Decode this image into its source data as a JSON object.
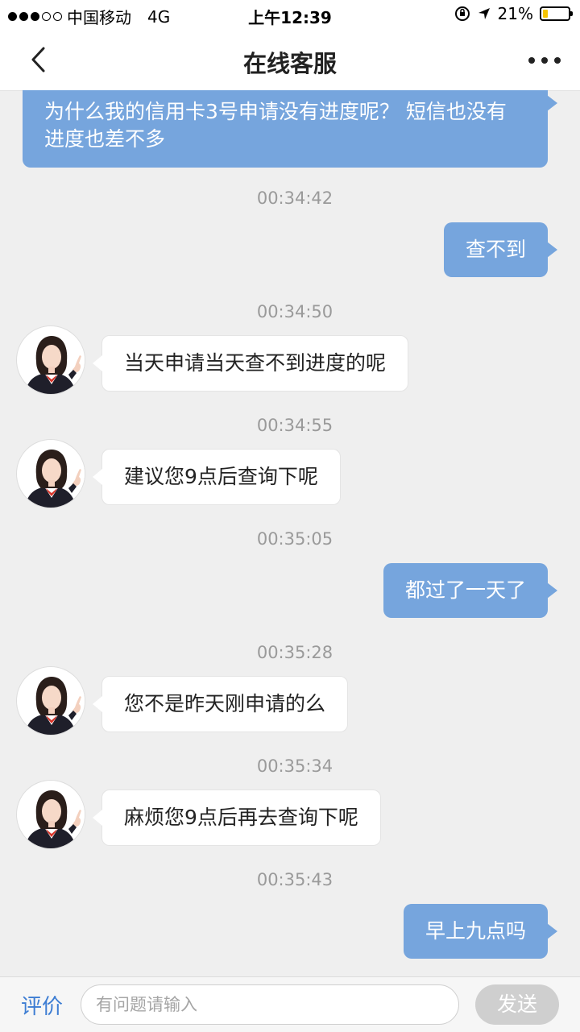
{
  "status_bar": {
    "carrier": "中国移动",
    "network": "4G",
    "time": "上午12:39",
    "battery_percent": "21%",
    "battery_level": 0.21
  },
  "header": {
    "title": "在线客服"
  },
  "messages": [
    {
      "from": "user",
      "text": "为什么我的信用卡3号申请没有进度呢？ 短信也没有进度也差不多"
    },
    {
      "from": "system",
      "time": "00:34:42"
    },
    {
      "from": "user",
      "text": "查不到"
    },
    {
      "from": "system",
      "time": "00:34:50"
    },
    {
      "from": "agent",
      "text": "当天申请当天查不到进度的呢"
    },
    {
      "from": "system",
      "time": "00:34:55"
    },
    {
      "from": "agent",
      "text": "建议您9点后查询下呢"
    },
    {
      "from": "system",
      "time": "00:35:05"
    },
    {
      "from": "user",
      "text": "都过了一天了"
    },
    {
      "from": "system",
      "time": "00:35:28"
    },
    {
      "from": "agent",
      "text": "您不是昨天刚申请的么"
    },
    {
      "from": "system",
      "time": "00:35:34"
    },
    {
      "from": "agent",
      "text": "麻烦您9点后再去查询下呢"
    },
    {
      "from": "system",
      "time": "00:35:43"
    },
    {
      "from": "user",
      "text": "早上九点吗"
    }
  ],
  "input_bar": {
    "rate_label": "评价",
    "placeholder": "有问题请输入",
    "send_label": "发送"
  },
  "colors": {
    "user_bubble": "#76a5dd",
    "agent_bubble": "#ffffff",
    "link_blue": "#3d7dd3",
    "background": "#efefef"
  }
}
